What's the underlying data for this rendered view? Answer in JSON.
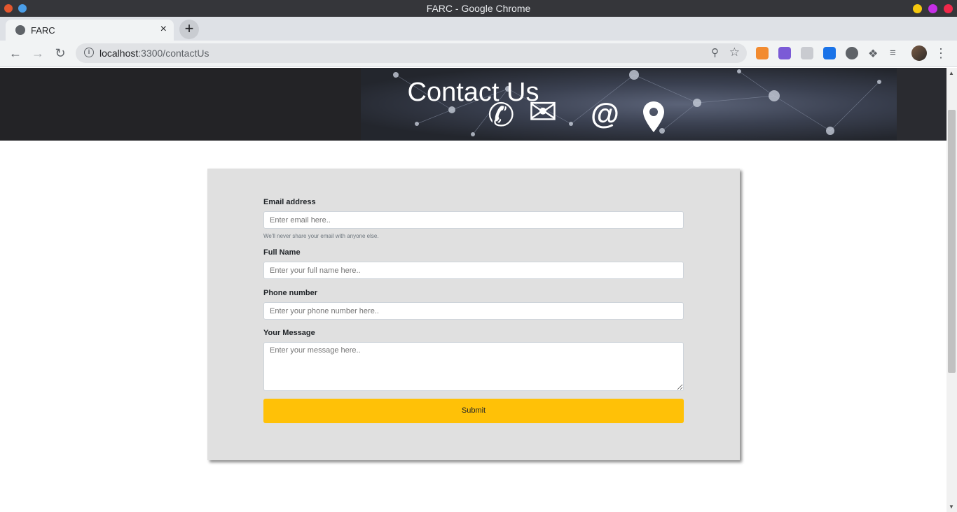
{
  "window": {
    "title": "FARC - Google Chrome"
  },
  "tab": {
    "title": "FARC",
    "close_label": "×",
    "new_tab_label": "+"
  },
  "toolbar": {
    "back_label": "←",
    "forward_label": "→",
    "reload_label": "↻",
    "url_host": "localhost",
    "url_path": ":3300/contactUs",
    "zoom_icon": "zoom-icon",
    "star_icon": "star-icon",
    "menu_label": "⋮"
  },
  "hero": {
    "title": "Contact Us",
    "icons": {
      "phone": "✆",
      "mail": "✉",
      "at": "@",
      "pin": "location-pin-icon"
    }
  },
  "form": {
    "email": {
      "label": "Email address",
      "placeholder": "Enter email here..",
      "help": "We'll never share your email with anyone else."
    },
    "name": {
      "label": "Full Name",
      "placeholder": "Enter your full name here.."
    },
    "phone": {
      "label": "Phone number",
      "placeholder": "Enter your phone number here.."
    },
    "message": {
      "label": "Your Message",
      "placeholder": "Enter your message here.."
    },
    "submit_label": "Submit"
  },
  "colors": {
    "accent": "#ffc107",
    "card": "#e0e0e0",
    "chrome": "#35363a"
  }
}
